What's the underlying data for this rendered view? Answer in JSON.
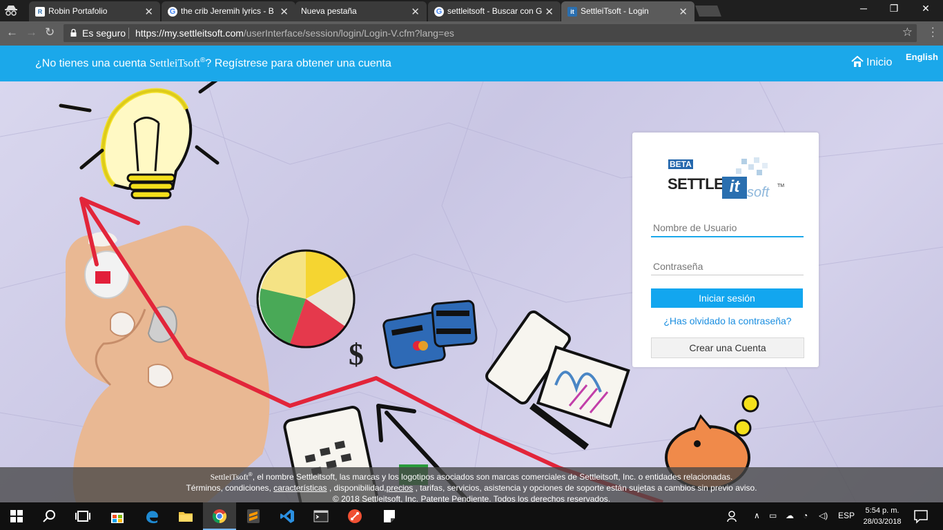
{
  "browser": {
    "tabs": [
      {
        "title": "Robin Portafolio",
        "favicon": "robin-favicon",
        "active": false
      },
      {
        "title": "the crib Jeremih lyrics - B",
        "favicon": "google-favicon",
        "active": false
      },
      {
        "title": "Nueva pestaña",
        "favicon": "none",
        "active": false
      },
      {
        "title": "settleitsoft - Buscar con G",
        "favicon": "google-favicon",
        "active": false
      },
      {
        "title": "SettleiTsoft - Login",
        "favicon": "settleitsoft-favicon",
        "active": true
      }
    ],
    "secure_label": "Es seguro",
    "url_host": "https://my.settleitsoft.com",
    "url_path": "/userInterface/session/login/Login-V.cfm?lang=es"
  },
  "header": {
    "register_brand": "SettleiTsoft",
    "register_reg": "®",
    "register_text": "? Regístrese para obtener una cuenta",
    "register_prefix": "¿No tienes una cuenta ",
    "home_label": "Inicio",
    "language_link": "English",
    "bg_color": "#1ba8ea"
  },
  "login": {
    "logo": {
      "beta": "BETA",
      "settle": "SETTLE",
      "it": "it",
      "soft": "soft",
      "tm": "TM"
    },
    "username_placeholder": "Nombre de Usuario",
    "password_placeholder": "Contraseña",
    "login_button": "Iniciar sesión",
    "forgot_link": "¿Has olvidado la contraseña?",
    "create_button": "Crear una Cuenta",
    "accent_color": "#12a6ef"
  },
  "footer": {
    "line1_brand": "SettleiTsoft",
    "line1_reg": "®",
    "line1_text": ", el nombre Settleitsoft, las marcas y los logotipos asociados son marcas comerciales de Settleitsoft, Inc. o entidades relacionadas.",
    "line2_a": "Términos, condiciones, ",
    "line2_link1": "características",
    "line2_b": " , disponibilidad,",
    "line2_link2": "precios",
    "line2_c": " , tarifas, servicios, asistencia y opciones de soporte están sujetas a cambios sin previo aviso.",
    "line3": "© 2018 Settleitsoft, Inc. Patente Pendiente. Todos los derechos reservados."
  },
  "taskbar": {
    "apps": [
      "start-icon",
      "search-icon",
      "task-view-icon",
      "store-icon",
      "edge-icon",
      "file-explorer-icon",
      "chrome-icon",
      "sublime-icon",
      "vscode-icon",
      "terminal-icon",
      "git-icon",
      "notes-icon"
    ],
    "language": "ESP",
    "time": "5:54 p. m.",
    "date": "28/03/2018"
  }
}
